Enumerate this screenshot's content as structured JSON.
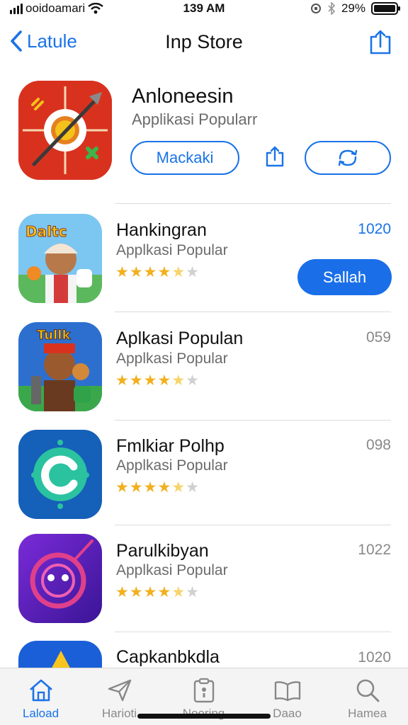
{
  "status_bar": {
    "carrier": "ooidoamari",
    "time": "139 AM",
    "battery": "29%"
  },
  "nav": {
    "back_label": "Latule",
    "title": "Inp Store"
  },
  "featured": {
    "name": "Anloneesin",
    "subtitle": "Applikasi Popularr",
    "open_label": "Mackaki"
  },
  "apps": [
    {
      "name": "Hankingran",
      "subtitle": "Applkasi  Popular",
      "count": "1020",
      "rating": 4.5,
      "action_label": "Sallah"
    },
    {
      "name": "Aplkasi Populan",
      "subtitle": "Applkasi  Popular",
      "count": "059",
      "rating": 4.5
    },
    {
      "name": "Fmlkiar Polhp",
      "subtitle": "Applkasi  Popular",
      "count": "098",
      "rating": 4.5
    },
    {
      "name": "Parulkibyan",
      "subtitle": "Applkasi  Popular",
      "count": "1022",
      "rating": 4.5
    },
    {
      "name": "Capkanbkdla",
      "count": "1020"
    }
  ],
  "tabs": [
    {
      "label": "Laload",
      "icon": "home-icon",
      "active": true
    },
    {
      "label": "Harioti",
      "icon": "send-icon",
      "active": false
    },
    {
      "label": "Nooring",
      "icon": "clipboard-icon",
      "active": false
    },
    {
      "label": "Daao",
      "icon": "book-icon",
      "active": false
    },
    {
      "label": "Hamea",
      "icon": "search-icon",
      "active": false
    }
  ],
  "colors": {
    "accent": "#1a73e8",
    "star": "#f2b01e"
  }
}
